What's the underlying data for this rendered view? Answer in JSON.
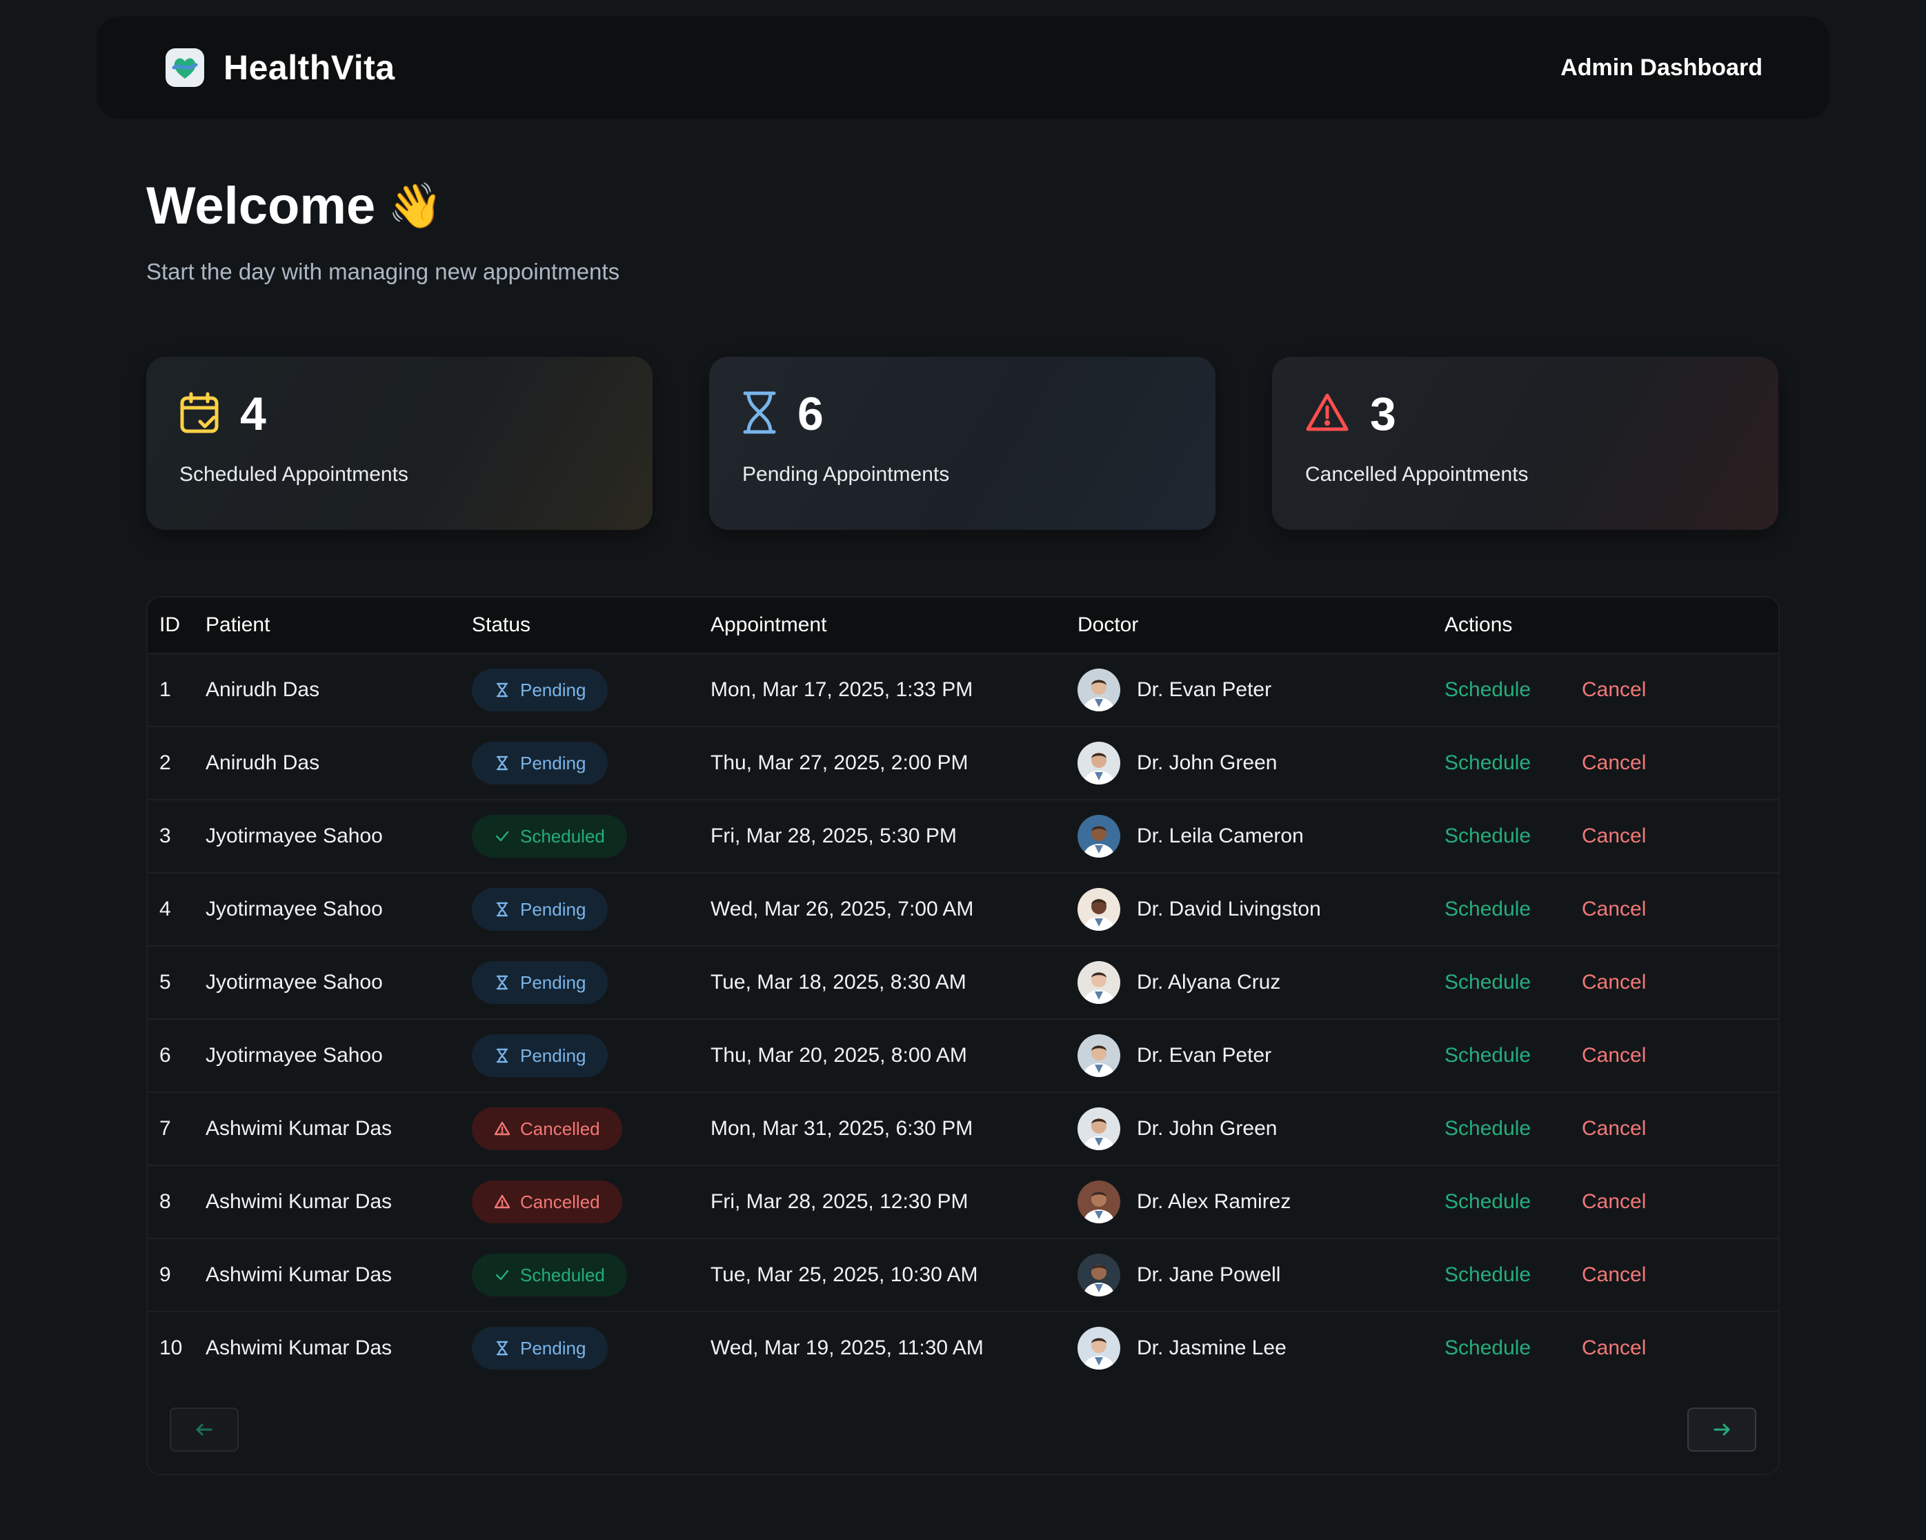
{
  "header": {
    "brand": "HealthVita",
    "admin_label": "Admin Dashboard"
  },
  "welcome": {
    "title": "Welcome",
    "emoji": "👋",
    "subtitle": "Start the day with managing new appointments"
  },
  "stats": [
    {
      "count": "4",
      "label": "Scheduled Appointments",
      "icon": "calendar-check-icon",
      "color": "#ffd147"
    },
    {
      "count": "6",
      "label": "Pending Appointments",
      "icon": "hourglass-icon",
      "color": "#79b5ec"
    },
    {
      "count": "3",
      "label": "Cancelled Appointments",
      "icon": "alert-triangle-icon",
      "color": "#ff4f4e"
    }
  ],
  "table": {
    "columns": [
      "ID",
      "Patient",
      "Status",
      "Appointment",
      "Doctor",
      "Actions"
    ],
    "rows": [
      {
        "id": "1",
        "patient": "Anirudh Das",
        "status": "Pending",
        "appointment": "Mon, Mar 17, 2025, 1:33 PM",
        "doctor": "Dr. Evan Peter"
      },
      {
        "id": "2",
        "patient": "Anirudh Das",
        "status": "Pending",
        "appointment": "Thu, Mar 27, 2025, 2:00 PM",
        "doctor": "Dr. John Green"
      },
      {
        "id": "3",
        "patient": "Jyotirmayee Sahoo",
        "status": "Scheduled",
        "appointment": "Fri, Mar 28, 2025, 5:30 PM",
        "doctor": "Dr. Leila Cameron"
      },
      {
        "id": "4",
        "patient": "Jyotirmayee Sahoo",
        "status": "Pending",
        "appointment": "Wed, Mar 26, 2025, 7:00 AM",
        "doctor": "Dr. David Livingston"
      },
      {
        "id": "5",
        "patient": "Jyotirmayee Sahoo",
        "status": "Pending",
        "appointment": "Tue, Mar 18, 2025, 8:30 AM",
        "doctor": "Dr. Alyana Cruz"
      },
      {
        "id": "6",
        "patient": "Jyotirmayee Sahoo",
        "status": "Pending",
        "appointment": "Thu, Mar 20, 2025, 8:00 AM",
        "doctor": "Dr. Evan Peter"
      },
      {
        "id": "7",
        "patient": "Ashwimi Kumar Das",
        "status": "Cancelled",
        "appointment": "Mon, Mar 31, 2025, 6:30 PM",
        "doctor": "Dr. John Green"
      },
      {
        "id": "8",
        "patient": "Ashwimi Kumar Das",
        "status": "Cancelled",
        "appointment": "Fri, Mar 28, 2025, 12:30 PM",
        "doctor": "Dr. Alex Ramirez"
      },
      {
        "id": "9",
        "patient": "Ashwimi Kumar Das",
        "status": "Scheduled",
        "appointment": "Tue, Mar 25, 2025, 10:30 AM",
        "doctor": "Dr. Jane Powell"
      },
      {
        "id": "10",
        "patient": "Ashwimi Kumar Das",
        "status": "Pending",
        "appointment": "Wed, Mar 19, 2025, 11:30 AM",
        "doctor": "Dr. Jasmine Lee"
      }
    ],
    "actions": {
      "schedule": "Schedule",
      "cancel": "Cancel"
    }
  },
  "pagination": {
    "prev_icon": "arrow-left-icon",
    "next_icon": "arrow-right-icon"
  },
  "colors": {
    "accent_green": "#24ae7c",
    "accent_red": "#f37877",
    "accent_blue": "#79b5ec",
    "background": "#131619"
  }
}
